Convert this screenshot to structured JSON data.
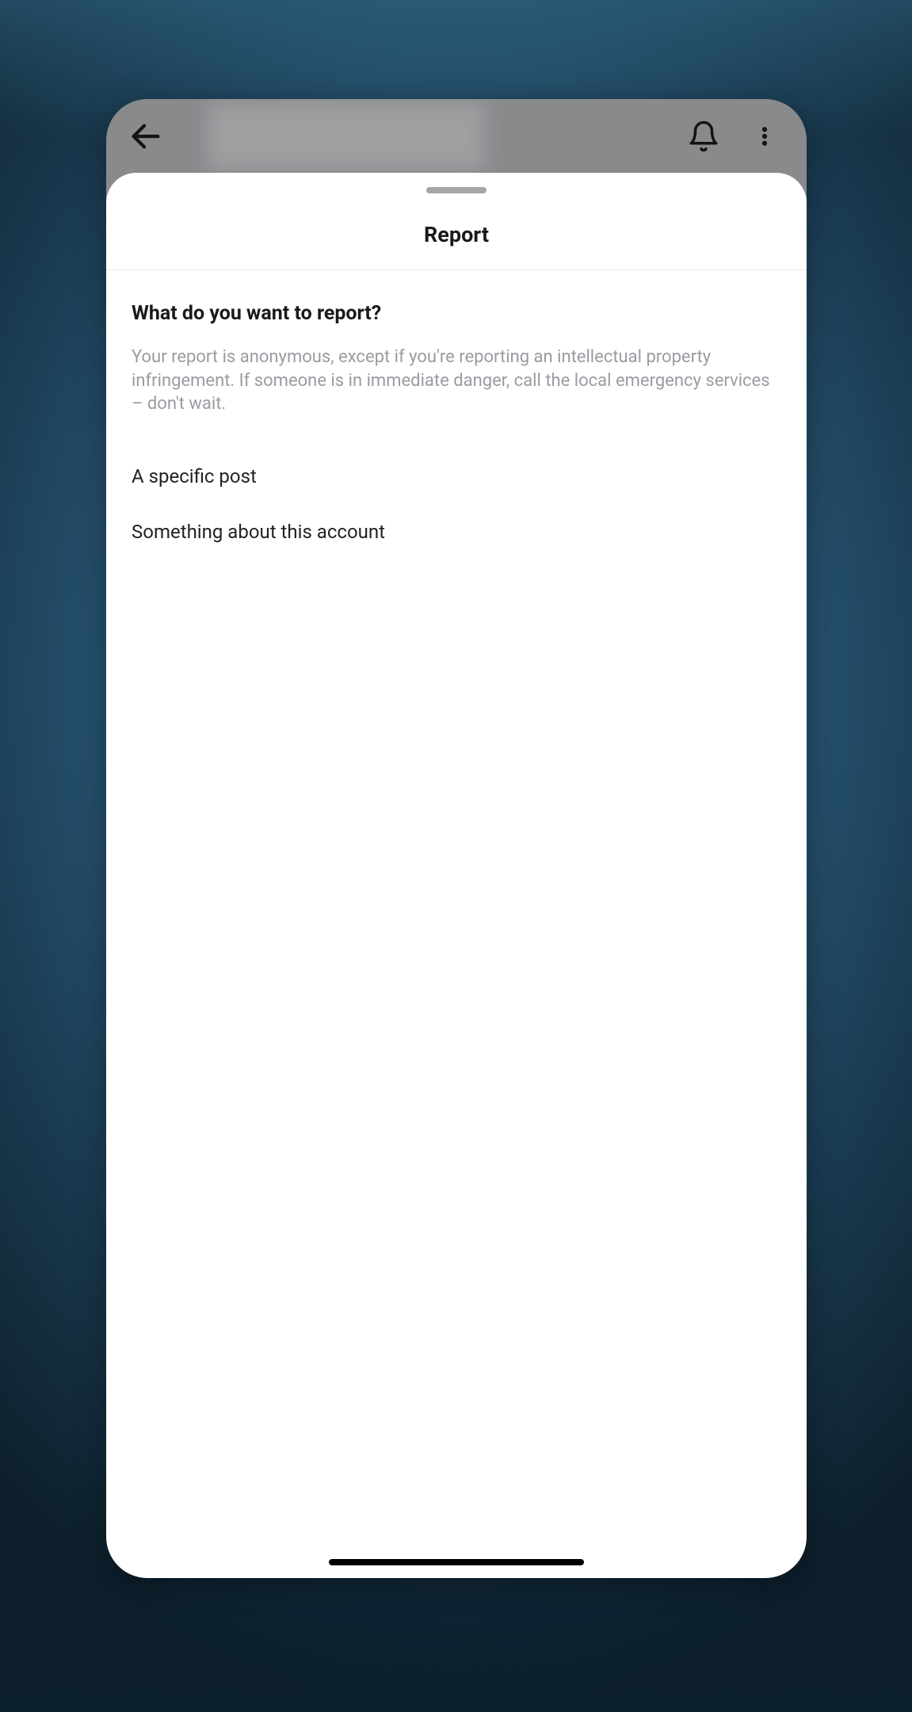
{
  "topbar": {
    "back_icon": "arrow-left-icon",
    "notification_icon": "bell-icon",
    "menu_icon": "more-vertical-icon"
  },
  "sheet": {
    "title": "Report",
    "question": "What do you want to report?",
    "disclaimer": "Your report is anonymous, except if you're reporting an intellectual property infringement. If someone is in immediate danger, call the local emergency services – don't wait.",
    "options": [
      "A specific post",
      "Something about this account"
    ]
  }
}
